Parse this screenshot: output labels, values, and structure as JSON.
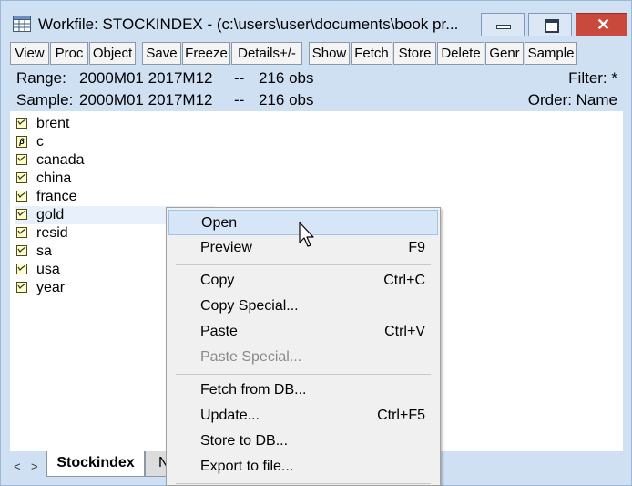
{
  "window": {
    "title": "Workfile: STOCKINDEX - (c:\\users\\user\\documents\\book pr...",
    "icon": "workfile-grid-icon",
    "controls": [
      "minimize-icon",
      "maximize-icon",
      "close-icon"
    ],
    "close_glyph": "✕"
  },
  "toolbar": {
    "buttons": [
      "View",
      "Proc",
      "Object",
      "Save",
      "Freeze",
      "Details+/-",
      "Show",
      "Fetch",
      "Store",
      "Delete",
      "Genr",
      "Sample"
    ]
  },
  "info": {
    "range_label": "Range:",
    "range_value": "2000M01 2017M12",
    "range_sep": "--",
    "range_obs": "216 obs",
    "sample_label": "Sample:",
    "sample_value": "2000M01 2017M12",
    "sample_sep": "--",
    "sample_obs": "216 obs",
    "filter": "Filter: *",
    "order": "Order: Name"
  },
  "objects": [
    {
      "name": "brent",
      "icon": "series-icon"
    },
    {
      "name": "c",
      "icon": "coefficient-icon",
      "glyph": "β"
    },
    {
      "name": "canada",
      "icon": "series-icon"
    },
    {
      "name": "china",
      "icon": "series-icon"
    },
    {
      "name": "france",
      "icon": "series-icon"
    },
    {
      "name": "gold",
      "icon": "series-icon",
      "selected": true
    },
    {
      "name": "resid",
      "icon": "series-icon"
    },
    {
      "name": "sa",
      "icon": "series-icon"
    },
    {
      "name": "usa",
      "icon": "series-icon"
    },
    {
      "name": "year",
      "icon": "series-icon"
    }
  ],
  "tabs": {
    "left_arrow": "<",
    "right_arrow": ">",
    "active": "Stockindex",
    "partial": "N"
  },
  "context_menu": {
    "items": [
      {
        "label": "Open",
        "shortcut": "",
        "highlighted": true
      },
      {
        "label": "Preview",
        "shortcut": "F9"
      },
      {
        "label": "Copy",
        "shortcut": "Ctrl+C"
      },
      {
        "label": "Copy Special...",
        "shortcut": ""
      },
      {
        "label": "Paste",
        "shortcut": "Ctrl+V"
      },
      {
        "label": "Paste Special...",
        "shortcut": "",
        "disabled": true
      },
      {
        "label": "Fetch from DB...",
        "shortcut": ""
      },
      {
        "label": "Update...",
        "shortcut": "Ctrl+F5"
      },
      {
        "label": "Store to DB...",
        "shortcut": ""
      },
      {
        "label": "Export to file...",
        "shortcut": ""
      }
    ]
  },
  "colors": {
    "chrome": "#cfe0f3",
    "highlight": "#d7e6f7",
    "close_button": "#c94a3d"
  }
}
